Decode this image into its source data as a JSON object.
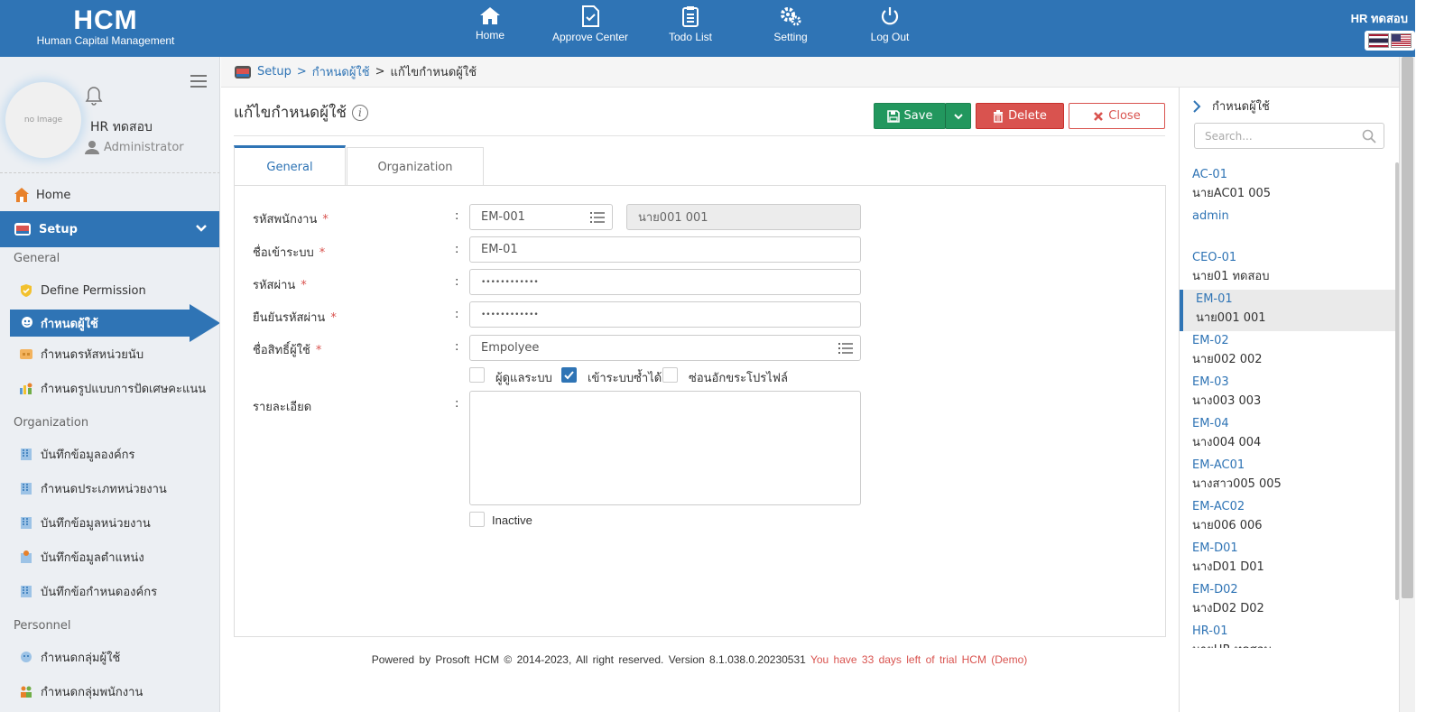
{
  "app": {
    "logo_text": "HCM",
    "subtitle": "Human Capital Management"
  },
  "topnav": [
    {
      "label": "Home",
      "icon": "home-icon"
    },
    {
      "label": "Approve Center",
      "icon": "document-check-icon"
    },
    {
      "label": "Todo List",
      "icon": "clipboard-list-icon"
    },
    {
      "label": "Setting",
      "icon": "gears-icon"
    },
    {
      "label": "Log Out",
      "icon": "power-icon"
    }
  ],
  "top_user": "HR ทดสอบ",
  "sidebar": {
    "avatar_text": "no Image",
    "user_name": "HR ทดสอบ",
    "role": "Administrator",
    "home_label": "Home",
    "setup_label": "Setup",
    "groups": {
      "general": "General",
      "organization": "Organization",
      "personnel": "Personnel"
    },
    "items": [
      "Define Permission",
      "กำหนดผู้ใช้",
      "กำหนดรหัสหน่วยนับ",
      "กำหนดรูปแบบการปัดเศษคะแนน",
      "บันทึกข้อมูลองค์กร",
      "กำหนดประเภทหน่วยงาน",
      "บันทึกข้อมูลหน่วยงาน",
      "บันทึกข้อมูลตำแหน่ง",
      "บันทึกข้อกำหนดองค์กร",
      "กำหนดกลุ่มผู้ใช้",
      "กำหนดกลุ่มพนักงาน"
    ]
  },
  "breadcrumb": {
    "setup": "Setup",
    "sep1": ">",
    "parent": "กำหนดผู้ใช้",
    "sep2": ">",
    "current": "แก้ไขกำหนดผู้ใช้"
  },
  "page": {
    "title": "แก้ไขกำหนดผู้ใช้",
    "info_glyph": "i"
  },
  "buttons": {
    "save": "Save",
    "delete": "Delete",
    "close": "Close"
  },
  "tabs": [
    "General",
    "Organization"
  ],
  "form": {
    "employee_code_label": "รหัสพนักงาน",
    "employee_code_value": "EM-001",
    "employee_name_value": "นาย001 001",
    "login_label": "ชื่อเข้าระบบ",
    "login_value": "EM-01",
    "password_label": "รหัสผ่าน",
    "password_value": "••••••••••••",
    "confirm_label": "ยืนยันรหัสผ่าน",
    "confirm_value": "••••••••••••",
    "role_label": "ชื่อสิทธิ์ผู้ใช้",
    "role_value": "Empolyee",
    "required_mark": "*",
    "colon": ":",
    "admin_check_label": "ผู้ดูแลระบบ",
    "admin_checked": false,
    "multi_login_label": "เข้าระบบซ้ำได้",
    "multi_login_checked": true,
    "hide_profile_label": "ซ่อนอักขระโปรไฟล์",
    "hide_profile_checked": false,
    "detail_label": "รายละเอียด",
    "detail_value": "",
    "inactive_label": "Inactive",
    "inactive_checked": false
  },
  "footer": {
    "text": "Powered by Prosoft HCM © 2014-2023, All right reserved. Version 8.1.038.0.20230531",
    "trial": "You have 33 days left of trial HCM (Demo)"
  },
  "right_panel": {
    "title": "กำหนดผู้ใช้",
    "search_placeholder": "Search...",
    "users": [
      {
        "code": "AC-01",
        "name": "นายAC01 005"
      },
      {
        "code": "admin",
        "name": ""
      },
      {
        "code": "CEO-01",
        "name": "นาย01 ทดสอบ"
      },
      {
        "code": "EM-01",
        "name": "นาย001 001",
        "selected": true
      },
      {
        "code": "EM-02",
        "name": "นาย002 002"
      },
      {
        "code": "EM-03",
        "name": "นาง003 003"
      },
      {
        "code": "EM-04",
        "name": "นาง004 004"
      },
      {
        "code": "EM-AC01",
        "name": "นางสาว005 005"
      },
      {
        "code": "EM-AC02",
        "name": "นาย006 006"
      },
      {
        "code": "EM-D01",
        "name": "นางD01 D01"
      },
      {
        "code": "EM-D02",
        "name": "นางD02 D02"
      },
      {
        "code": "HR-01",
        "name": "นายHR ทดสอบ"
      }
    ]
  },
  "colors": {
    "brand_blue": "#2f74b5",
    "save_green": "#22975e",
    "danger_red": "#d9534f"
  }
}
